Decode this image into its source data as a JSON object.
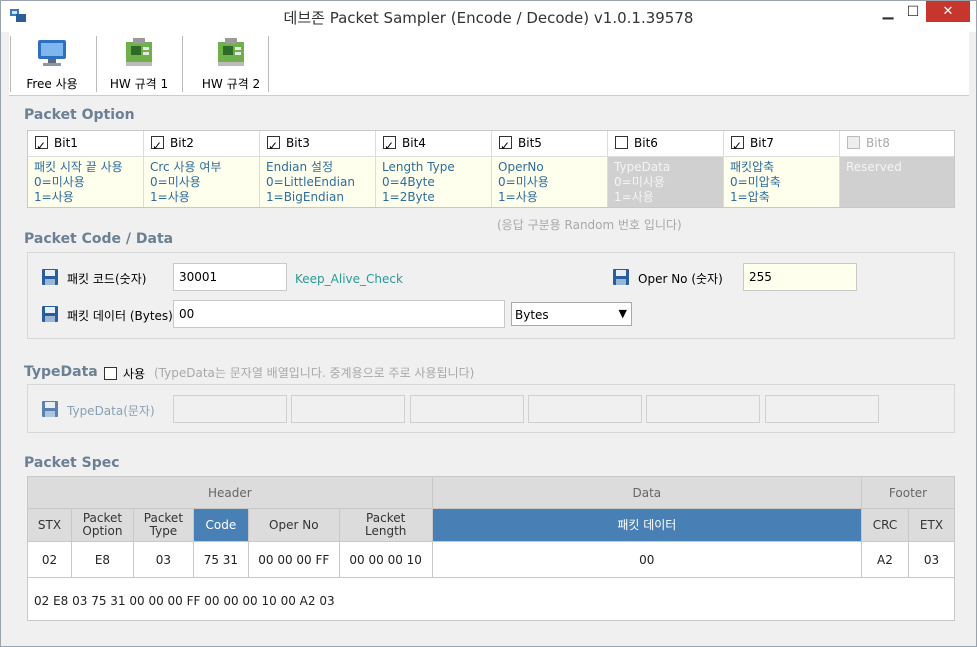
{
  "window": {
    "title": "데브존 Packet Sampler (Encode / Decode) v1.0.1.39578",
    "min_label": "▁",
    "max_label": "☐",
    "close_label": "✕"
  },
  "toolbar": {
    "items": [
      {
        "label": "Free 사용",
        "icon": "computer-icon"
      },
      {
        "label": "HW 규격 1",
        "icon": "hardware-board-icon"
      },
      {
        "label": "HW 규격 2",
        "icon": "hardware-board-icon"
      }
    ]
  },
  "packet_option": {
    "title": "Packet Option",
    "bits": [
      {
        "name": "Bit1",
        "checked": true,
        "enabled": true,
        "lines": [
          "패킷 시작 끝 사용",
          "0=미사용",
          "1=사용"
        ]
      },
      {
        "name": "Bit2",
        "checked": true,
        "enabled": true,
        "lines": [
          "Crc 사용 여부",
          "0=미사용",
          "1=사용"
        ]
      },
      {
        "name": "Bit3",
        "checked": true,
        "enabled": true,
        "lines": [
          "Endian 설정",
          "0=LittleEndian",
          "1=BigEndian"
        ]
      },
      {
        "name": "Bit4",
        "checked": true,
        "enabled": true,
        "lines": [
          "Length Type",
          "0=4Byte",
          "1=2Byte"
        ]
      },
      {
        "name": "Bit5",
        "checked": true,
        "enabled": true,
        "lines": [
          "OperNo",
          "0=미사용",
          "1=사용"
        ]
      },
      {
        "name": "Bit6",
        "checked": false,
        "enabled": true,
        "lines": [
          "TypeData",
          "0=미사용",
          "1=사용"
        ]
      },
      {
        "name": "Bit7",
        "checked": true,
        "enabled": true,
        "lines": [
          "패킷압축",
          "0=미압축",
          "1=압축"
        ]
      },
      {
        "name": "Bit8",
        "checked": false,
        "enabled": false,
        "lines": [
          "Reserved",
          "",
          ""
        ]
      }
    ],
    "hint": "(응답 구분용 Random 번호 입니다)"
  },
  "packet_code": {
    "title": "Packet Code / Data",
    "code_label": "패킷 코드(숫자)",
    "code_value": "30001",
    "code_name": "Keep_Alive_Check",
    "operno_label": "Oper No (숫자)",
    "operno_value": "255",
    "data_label": "패킷 데이터 (Bytes)",
    "data_value": "00",
    "format_selected": "Bytes"
  },
  "typedata": {
    "title": "TypeData",
    "use_label": "사용",
    "hint": "(TypeData는 문자열 배열입니다. 중계용으로 주로 사용됩니다)",
    "field_label": "TypeData(문자)",
    "use_checked": false
  },
  "packet_spec": {
    "title": "Packet Spec",
    "groups": [
      "Header",
      "Data",
      "Footer"
    ],
    "columns": [
      "STX",
      "Packet\nOption",
      "Packet\nType",
      "Code",
      "Oper No",
      "Packet\nLength",
      "패킷 데이터",
      "CRC",
      "ETX"
    ],
    "values": [
      "02",
      "E8",
      "03",
      "75 31",
      "00 00 00 FF",
      "00 00 00 10",
      "00",
      "A2",
      "03"
    ],
    "raw_bytes": "02 E8 03 75 31 00 00 00 FF 00 00 00 10 00 A2 03"
  }
}
